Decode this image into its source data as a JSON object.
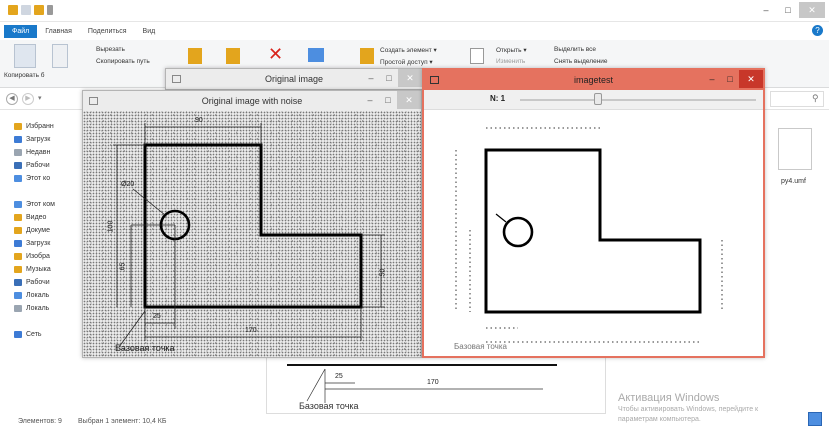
{
  "explorer": {
    "window_controls": {
      "minimize": "–",
      "maximize": "□",
      "close": "✕"
    },
    "help_icon": "?",
    "menu": {
      "file": "Файл",
      "tabs": [
        "Главная",
        "Поделиться",
        "Вид"
      ]
    },
    "ribbon": {
      "copy_label": "Копировать",
      "copy_path_label": "Копировать б",
      "cut": "Вырезать",
      "copy_path": "Скопировать путь",
      "new_item": "Создать элемент ▾",
      "easy_access": "Простой доступ ▾",
      "open": "Открыть ▾",
      "edit": "Изменить",
      "select_all": "Выделить все",
      "deselect": "Снять выделение"
    },
    "nav_pane": [
      {
        "label": "Избранн",
        "color": "#e3a51d"
      },
      {
        "label": "Загрузк",
        "color": "#3d7bd5"
      },
      {
        "label": "Недавн",
        "color": "#9aa5b1"
      },
      {
        "label": "Рабочи",
        "color": "#3a6fb7"
      },
      {
        "label": "Этот ко",
        "color": "#4d8ee0"
      },
      {
        "label": "",
        "color": ""
      },
      {
        "label": "Этот ком",
        "color": "#4d8ee0"
      },
      {
        "label": "Видео",
        "color": "#e3a51d"
      },
      {
        "label": "Докуме",
        "color": "#e3a51d"
      },
      {
        "label": "Загрузк",
        "color": "#3d7bd5"
      },
      {
        "label": "Изобра",
        "color": "#e3a51d"
      },
      {
        "label": "Музыка",
        "color": "#e3a51d"
      },
      {
        "label": "Рабочи",
        "color": "#3a6fb7"
      },
      {
        "label": "Локаль",
        "color": "#4d8ee0"
      },
      {
        "label": "Локаль",
        "color": "#9aa5b1"
      },
      {
        "label": "",
        "color": ""
      },
      {
        "label": "Сеть",
        "color": "#3d7bd5"
      }
    ],
    "file_item": {
      "name": "py4.umf"
    },
    "status": {
      "count": "Элементов: 9",
      "selected": "Выбран 1 элемент: 10,4 КБ"
    },
    "watermark": {
      "title": "Активация Windows",
      "line1": "Чтобы активировать Windows, перейдите к",
      "line2": "параметрам компьютера."
    }
  },
  "windows": {
    "original": {
      "title": "Original image"
    },
    "noise": {
      "title": "Original image with noise"
    },
    "imagetest": {
      "title": "imagetest",
      "trackbar_label": "N: 1",
      "trackbar_value": 0.33
    }
  },
  "drawing": {
    "dim_top": "90",
    "dim_bottom": "170",
    "dim_left_small": "25",
    "dim_diameter": "Ø20",
    "dim_height_total": "100",
    "dim_height_inner": "65",
    "dim_height_right": "50",
    "base_point": "Базовая точка",
    "dim_small_hidden": "25",
    "dim_large_hidden": "170"
  },
  "colors": {
    "accent": "#1979ca",
    "focus_border": "#e5725f",
    "close_red": "#c8372a"
  }
}
